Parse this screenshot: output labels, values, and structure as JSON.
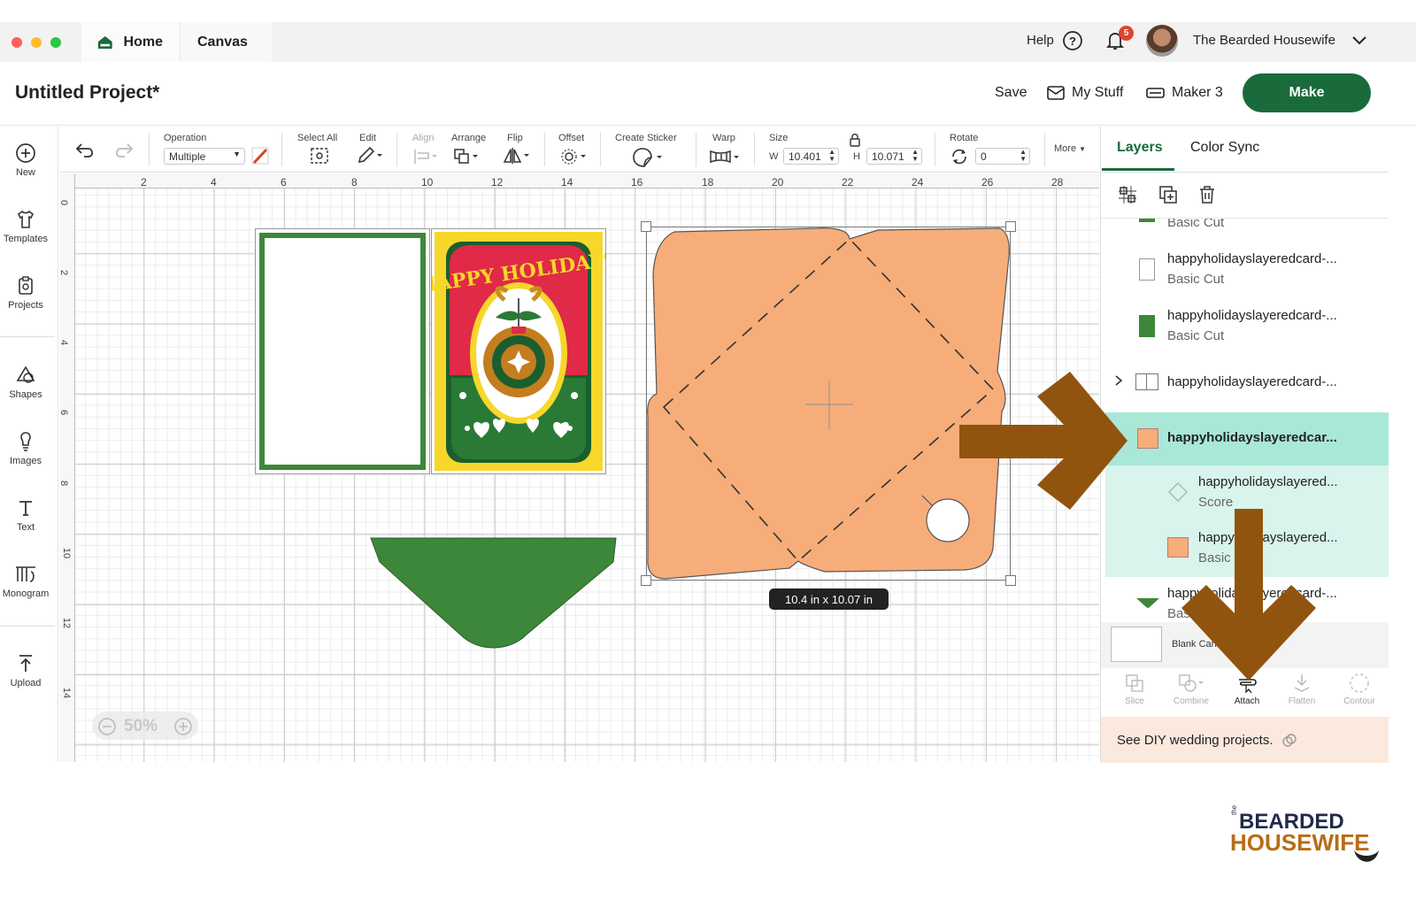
{
  "titlebar": {
    "home_label": "Home",
    "canvas_label": "Canvas",
    "help_label": "Help",
    "notification_count": "5",
    "user_name": "The Bearded Housewife"
  },
  "project": {
    "title": "Untitled Project*",
    "save_label": "Save",
    "my_stuff_label": "My Stuff",
    "machine_label": "Maker 3",
    "make_label": "Make"
  },
  "left_toolbar": {
    "items": [
      "New",
      "Templates",
      "Projects",
      "Shapes",
      "Images",
      "Text",
      "Monogram",
      "Upload"
    ]
  },
  "edit_toolbar": {
    "operation_label": "Operation",
    "operation_value": "Multiple",
    "select_all_label": "Select All",
    "edit_label": "Edit",
    "align_label": "Align",
    "arrange_label": "Arrange",
    "flip_label": "Flip",
    "offset_label": "Offset",
    "create_sticker_label": "Create Sticker",
    "warp_label": "Warp",
    "size_label": "Size",
    "w_label": "W",
    "w_value": "10.401",
    "h_label": "H",
    "h_value": "10.071",
    "rotate_label": "Rotate",
    "rotate_value": "0",
    "more_label": "More"
  },
  "ruler": {
    "top": [
      "2",
      "4",
      "6",
      "8",
      "10",
      "12",
      "14",
      "16",
      "18",
      "20",
      "22",
      "24",
      "26",
      "28"
    ],
    "left": [
      "0",
      "2",
      "4",
      "6",
      "8",
      "10",
      "12",
      "14"
    ]
  },
  "canvas": {
    "size_tooltip": "10.4  in x 10.07  in",
    "zoom_label": "50%",
    "card_text": "HAPPY HOLIDAYS"
  },
  "right_panel": {
    "tabs": [
      "Layers",
      "Color Sync"
    ],
    "layers": [
      {
        "name": "",
        "op": "Basic Cut"
      },
      {
        "name": "happyholidayslayeredcard-...",
        "op": "Basic Cut"
      },
      {
        "name": "happyholidayslayeredcard-...",
        "op": "Basic Cut"
      },
      {
        "name": "happyholidayslayeredcard-...",
        "op": ""
      },
      {
        "name": "happyholidayslayeredcar...",
        "op": ""
      },
      {
        "name": "happyholidayslayered...",
        "op": "Score"
      },
      {
        "name": "happyholidayslayered...",
        "op": "Basic"
      },
      {
        "name": "happyholidayslayeredcard-...",
        "op": "Basic Cut"
      }
    ],
    "blank_canvas_label": "Blank Canvas",
    "bottom_tools": [
      "Slice",
      "Combine",
      "Attach",
      "Flatten",
      "Contour"
    ],
    "banner_text": "See DIY wedding projects."
  },
  "watermark": {
    "line1": "BEARDED",
    "line2": "HOUSEWIFE",
    "prefix": "the"
  },
  "colors": {
    "make_green": "#1a6b3b",
    "envelope_orange": "#f6ad79",
    "flap_green": "#3d873b",
    "arrow_brown": "#91540f",
    "selected_layer": "#a9e8d6"
  }
}
